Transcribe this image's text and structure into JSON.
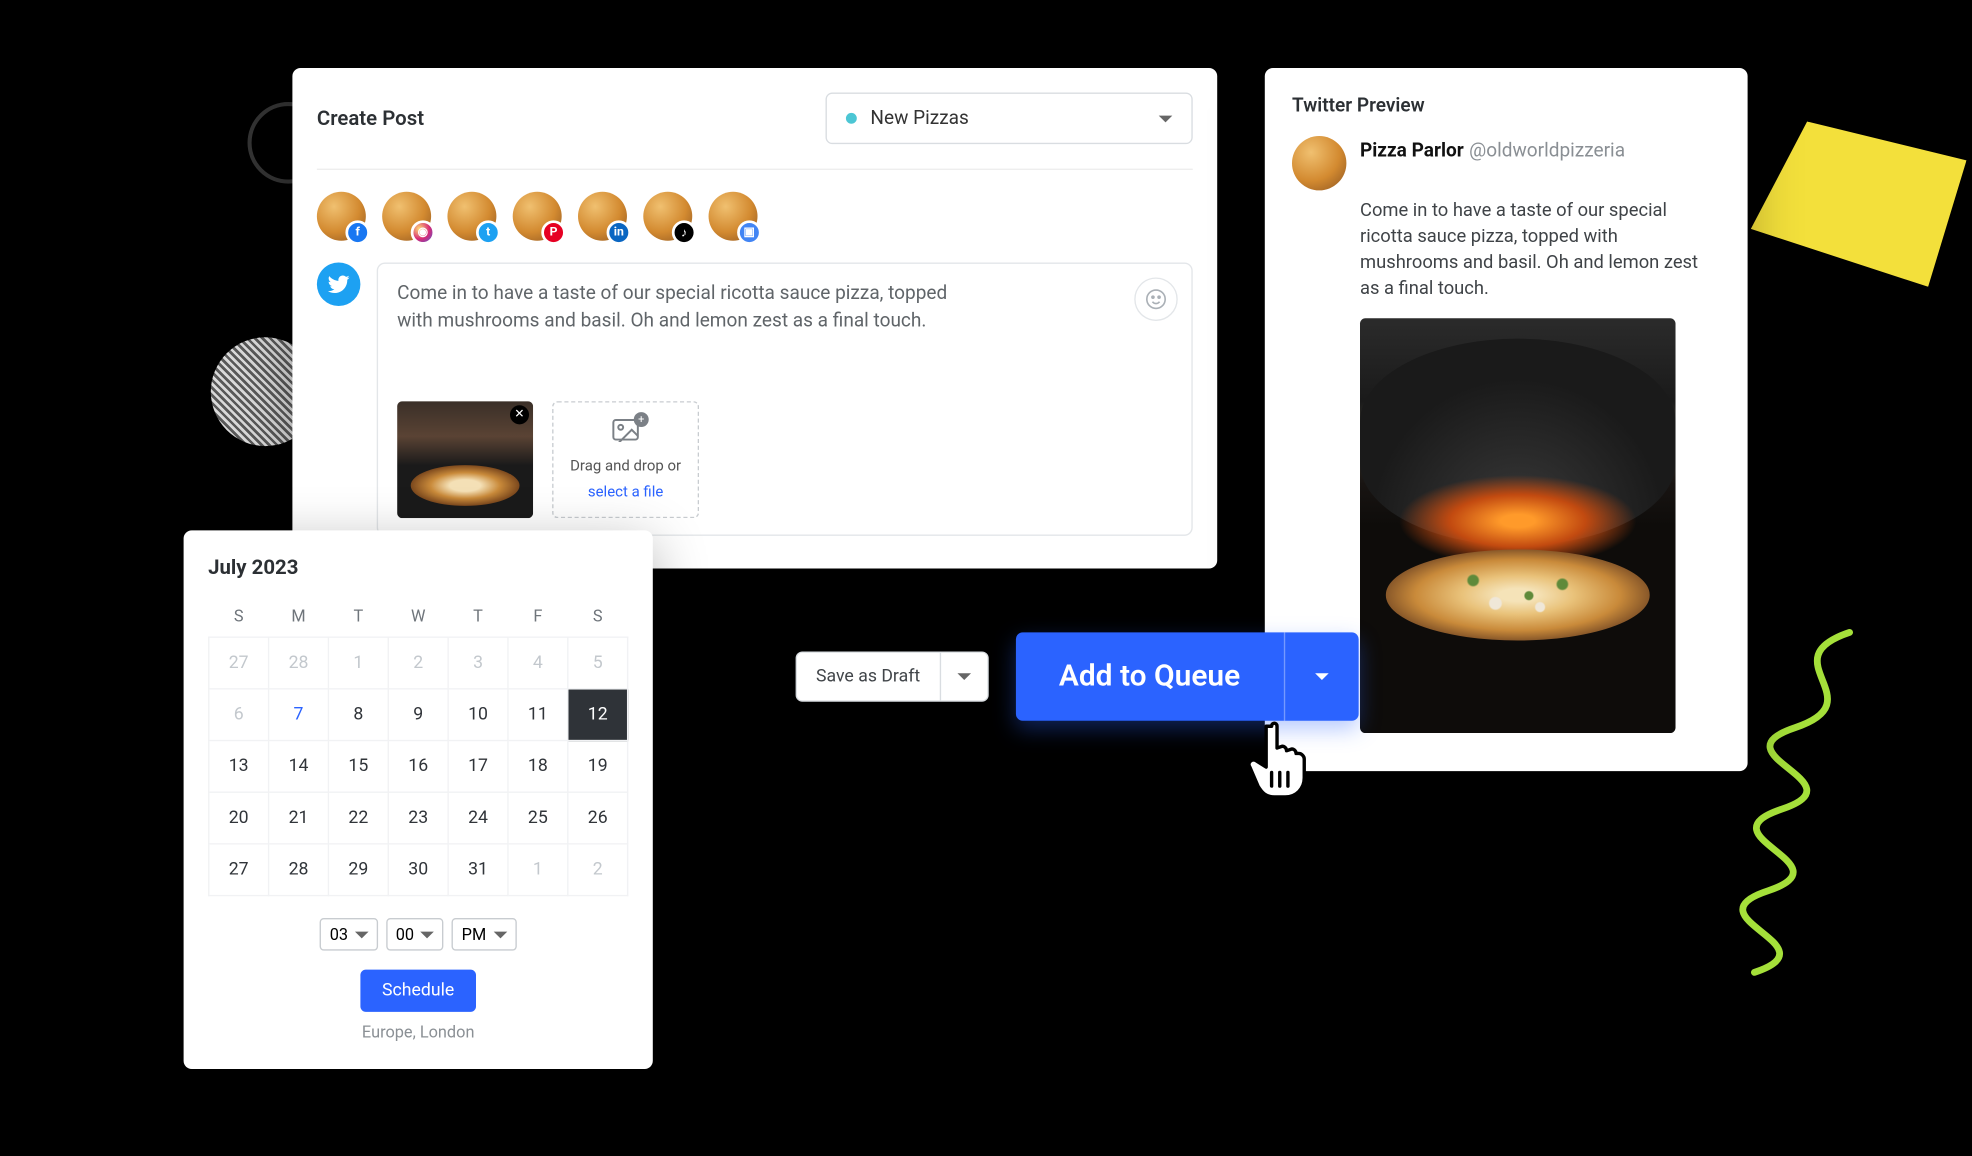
{
  "create": {
    "title": "Create Post",
    "campaign": "New Pizzas",
    "text": "Come in to have a taste of our special ricotta sauce pizza, topped with mushrooms and basil. Oh and lemon zest as a final touch.",
    "dropzone_line1": "Drag and drop or",
    "dropzone_link": "select a file"
  },
  "channels": [
    {
      "network": "facebook"
    },
    {
      "network": "instagram"
    },
    {
      "network": "twitter"
    },
    {
      "network": "pinterest"
    },
    {
      "network": "linkedin"
    },
    {
      "network": "tiktok"
    },
    {
      "network": "google-business"
    }
  ],
  "actions": {
    "draft": "Save as Draft",
    "queue": "Add to Queue"
  },
  "preview": {
    "title": "Twitter Preview",
    "name": "Pizza Parlor",
    "handle": "@oldworldpizzeria",
    "body": "Come in to have a taste of our special ricotta sauce pizza, topped with mushrooms and basil. Oh and lemon zest as a final touch."
  },
  "calendar": {
    "title": "July 2023",
    "dow": [
      "S",
      "M",
      "T",
      "W",
      "T",
      "F",
      "S"
    ],
    "weeks": [
      [
        {
          "d": "27",
          "m": true
        },
        {
          "d": "28",
          "m": true
        },
        {
          "d": "1",
          "m": true
        },
        {
          "d": "2",
          "m": true
        },
        {
          "d": "3",
          "m": true
        },
        {
          "d": "4",
          "m": true
        },
        {
          "d": "5",
          "m": true
        }
      ],
      [
        {
          "d": "6",
          "m": true
        },
        {
          "d": "7",
          "today": true
        },
        {
          "d": "8"
        },
        {
          "d": "9"
        },
        {
          "d": "10"
        },
        {
          "d": "11"
        },
        {
          "d": "12",
          "sel": true
        }
      ],
      [
        {
          "d": "13"
        },
        {
          "d": "14"
        },
        {
          "d": "15"
        },
        {
          "d": "16"
        },
        {
          "d": "17"
        },
        {
          "d": "18"
        },
        {
          "d": "19"
        }
      ],
      [
        {
          "d": "20"
        },
        {
          "d": "21"
        },
        {
          "d": "22"
        },
        {
          "d": "23"
        },
        {
          "d": "24"
        },
        {
          "d": "25"
        },
        {
          "d": "26"
        }
      ],
      [
        {
          "d": "27"
        },
        {
          "d": "28"
        },
        {
          "d": "29"
        },
        {
          "d": "30"
        },
        {
          "d": "31"
        },
        {
          "d": "1",
          "m": true
        },
        {
          "d": "2",
          "m": true
        }
      ]
    ],
    "hour": "03",
    "minute": "00",
    "ampm": "PM",
    "schedule": "Schedule",
    "timezone": "Europe, London"
  },
  "icons": {
    "fb": "f",
    "ig": "◉",
    "tw": "t",
    "pn": "P",
    "li": "in",
    "tk": "♪",
    "gb": "▣",
    "emoji": "☺",
    "image": "🖼",
    "close": "✕"
  }
}
